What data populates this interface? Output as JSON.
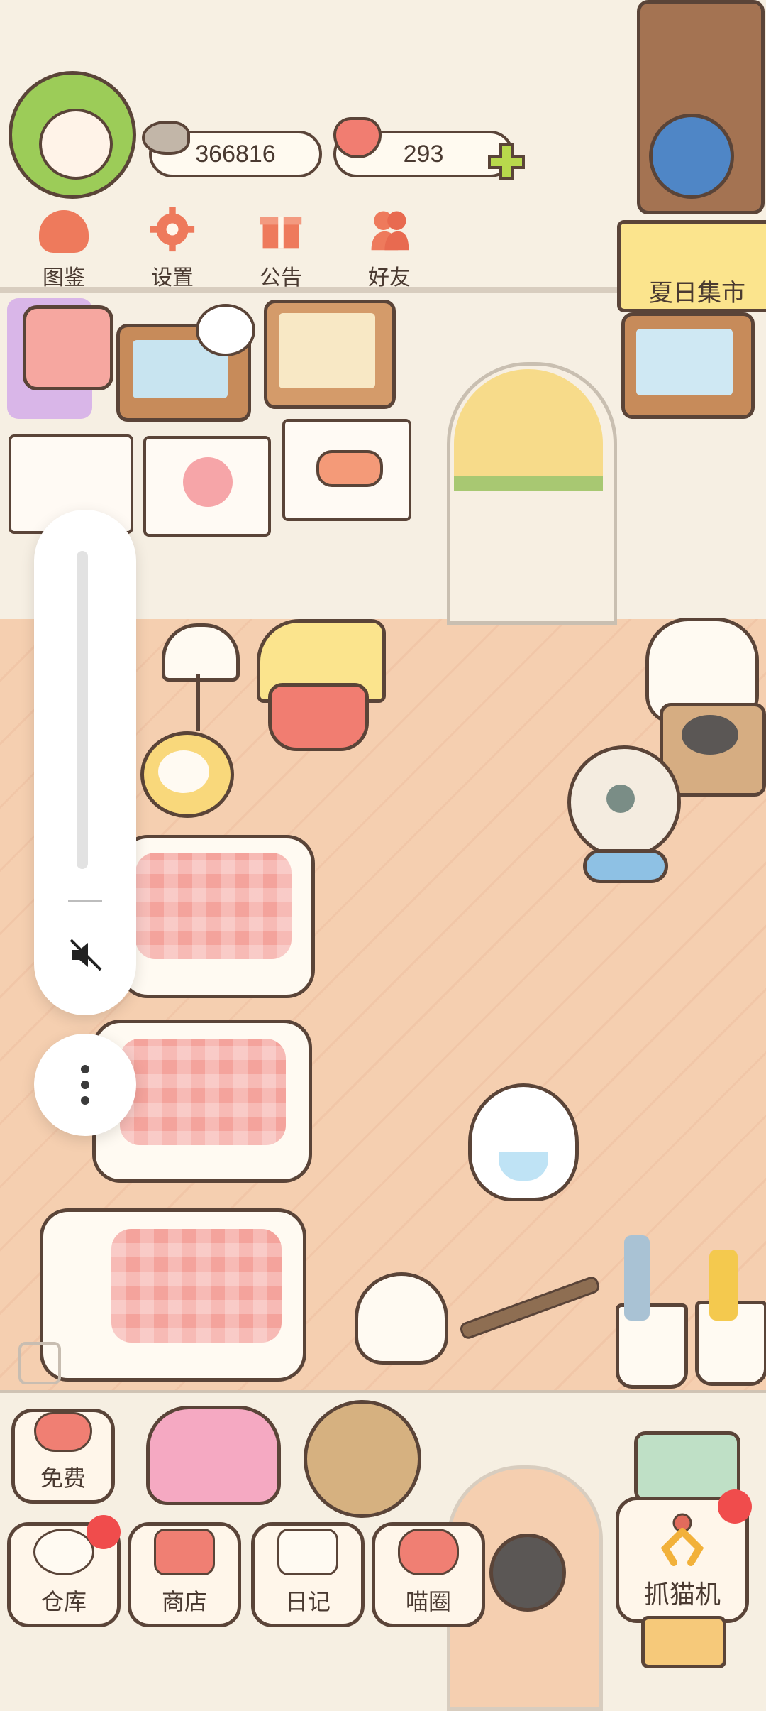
{
  "resources": {
    "coins": "366816",
    "hearts": "293"
  },
  "top_menu": [
    {
      "label": "图鉴",
      "icon": "cat-head-icon"
    },
    {
      "label": "设置",
      "icon": "gear-icon"
    },
    {
      "label": "公告",
      "icon": "gift-icon"
    },
    {
      "label": "好友",
      "icon": "friends-icon"
    }
  ],
  "event_banner": {
    "label": "夏日集市"
  },
  "bottom_menu": {
    "free": "免费",
    "warehouse": "仓库",
    "shop": "商店",
    "diary": "日记",
    "circle": "喵圈",
    "claw_machine": "抓猫机"
  },
  "colors": {
    "wall": "#f7f0e3",
    "floor": "#f5cfb0",
    "outline": "#5a4438",
    "accent_red": "#f04c4c",
    "accent_green": "#9ccc58"
  }
}
